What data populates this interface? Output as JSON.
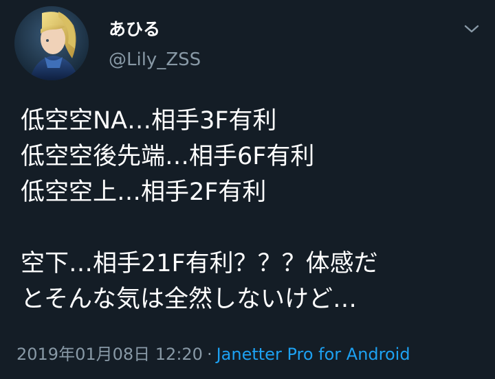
{
  "user": {
    "display_name": "あひる",
    "handle": "@Lily_ZSS"
  },
  "tweet": {
    "lines": [
      "低空空NA…相手3F有利",
      "低空空後先端…相手6F有利",
      "低空空上…相手2F有利",
      "",
      "空下…相手21F有利？？？体感だ",
      "とそんな気は全然しないけど…"
    ]
  },
  "footer": {
    "timestamp": "2019年01月08日 12:20",
    "separator": "·",
    "source": "Janetter Pro for Android"
  },
  "icons": {
    "menu": "chevron-down-icon",
    "avatar": "avatar-image"
  },
  "colors": {
    "background": "#141d26",
    "text": "#ffffff",
    "muted": "#8899a6",
    "link": "#1da1f2"
  }
}
